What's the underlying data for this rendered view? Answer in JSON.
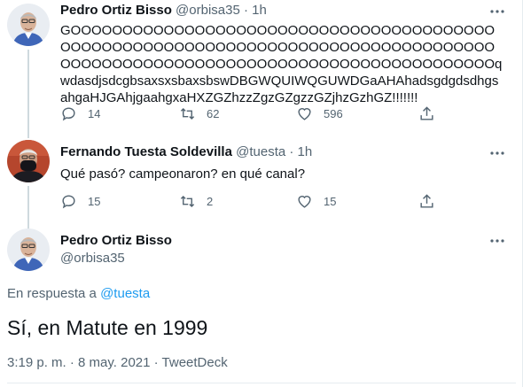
{
  "tweets": [
    {
      "name": "Pedro Ortiz Bisso",
      "handle": "@orbisa35",
      "sep": "·",
      "time": "1h",
      "text": "GOOOOOOOOOOOOOOOOOOOOOOOOOOOOOOOOOOOOOOOOOOOOOOOOOOOOOOOOOOOOOOOOOOOOOOOOOOOOOOOOOOOOOOOOOOOOOOOOOOOOOOOOOOOOOOOOOOOOOOOOOOOOOqwdasdjsdcgbsaxsxsbaxsbswDBGWQUIWQGUWDGaAHAhadsgdgdsdhgsahgaHJGAhjgaahgxaHXZGZhzzZgzGZgzzGZjhzGzhGZ!!!!!!!",
      "replies": "14",
      "retweets": "62",
      "likes": "596"
    },
    {
      "name": "Fernando Tuesta Soldevilla",
      "handle": "@tuesta",
      "sep": "·",
      "time": "1h",
      "text": "Qué pasó? campeonaron? en qué canal?",
      "replies": "15",
      "retweets": "2",
      "likes": "15"
    }
  ],
  "main": {
    "name": "Pedro Ortiz Bisso",
    "handle": "@orbisa35",
    "reply_prefix": "En respuesta a",
    "reply_to": "@tuesta",
    "text": "Sí, en Matute en 1999",
    "timestamp": "3:19 p. m. · 8 may. 2021 · TweetDeck"
  },
  "colors": {
    "accent": "#1d9bf0",
    "muted": "#536471",
    "divider": "#e6ecf0"
  },
  "icons": [
    "reply-icon",
    "retweet-icon",
    "like-icon",
    "share-icon",
    "more-icon"
  ]
}
